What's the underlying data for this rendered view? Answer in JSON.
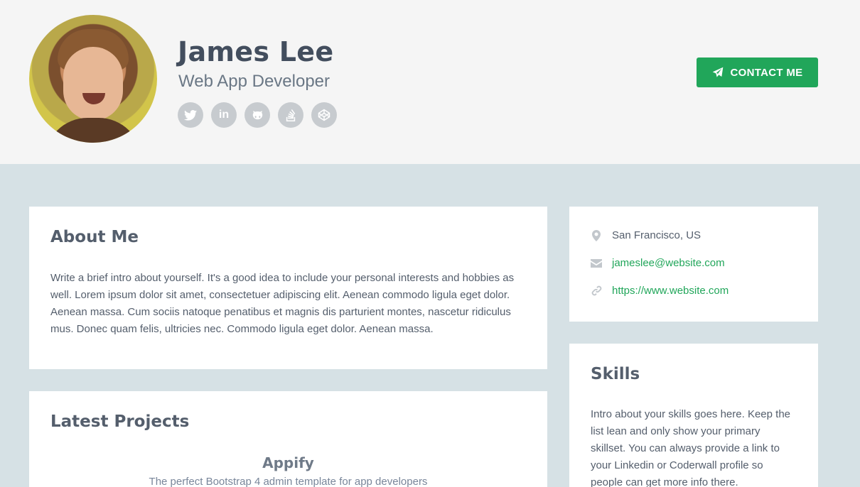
{
  "profile": {
    "name": "James Lee",
    "title": "Web App Developer",
    "contact_button": "CONTACT ME",
    "social": [
      {
        "icon": "twitter-icon"
      },
      {
        "icon": "linkedin-icon"
      },
      {
        "icon": "github-icon"
      },
      {
        "icon": "stackoverflow-icon"
      },
      {
        "icon": "codepen-icon"
      }
    ]
  },
  "about": {
    "heading": "About Me",
    "text": "Write a brief intro about yourself. It's a good idea to include your personal interests and hobbies as well. Lorem ipsum dolor sit amet, consectetuer adipiscing elit. Aenean commodo ligula eget dolor. Aenean massa. Cum sociis natoque penatibus et magnis dis parturient montes, nascetur ridiculus mus. Donec quam felis, ultricies nec. Commodo ligula eget dolor. Aenean massa."
  },
  "projects": {
    "heading": "Latest Projects",
    "items": [
      {
        "name": "Appify",
        "description": "The perfect Bootstrap 4 admin template for app developers"
      }
    ]
  },
  "info": {
    "location": "San Francisco, US",
    "email": "jameslee@website.com",
    "website": "https://www.website.com"
  },
  "skills": {
    "heading": "Skills",
    "text": "Intro about your skills goes here. Keep the list lean and only show your primary skillset. You can always provide a link to your Linkedin or Coderwall profile so people can get more info there."
  },
  "colors": {
    "accent": "#21a65a",
    "header_bg": "#f5f5f5",
    "page_bg": "#d6e1e5",
    "heading": "#545e6c"
  }
}
